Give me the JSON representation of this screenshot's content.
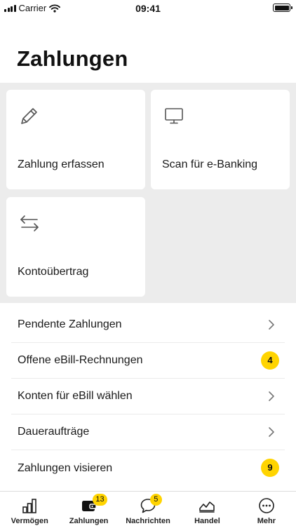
{
  "status_bar": {
    "carrier": "Carrier",
    "time": "09:41"
  },
  "page": {
    "title": "Zahlungen"
  },
  "tiles": [
    {
      "label": "Zahlung erfassen",
      "icon": "pencil-icon"
    },
    {
      "label": "Scan für e-Banking",
      "icon": "monitor-icon"
    },
    {
      "label": "Kontoübertrag",
      "icon": "transfer-arrows-icon"
    }
  ],
  "list": [
    {
      "label": "Pendente Zahlungen",
      "badge": null
    },
    {
      "label": "Offene eBill-Rechnungen",
      "badge": "4"
    },
    {
      "label": "Konten für eBill wählen",
      "badge": null
    },
    {
      "label": "Daueraufträge",
      "badge": null
    },
    {
      "label": "Zahlungen visieren",
      "badge": "9"
    }
  ],
  "tab_bar": {
    "tabs": [
      {
        "label": "Vermögen",
        "icon": "bar-chart-icon",
        "badge": null
      },
      {
        "label": "Zahlungen",
        "icon": "wallet-icon",
        "badge": "13",
        "active": true
      },
      {
        "label": "Nachrichten",
        "icon": "chat-bubble-icon",
        "badge": "5"
      },
      {
        "label": "Handel",
        "icon": "stock-chart-icon",
        "badge": null
      },
      {
        "label": "Mehr",
        "icon": "more-icon",
        "badge": null
      }
    ]
  },
  "colors": {
    "accent": "#ffd400",
    "tile_background": "#ececec",
    "text": "#1a1a1a"
  }
}
